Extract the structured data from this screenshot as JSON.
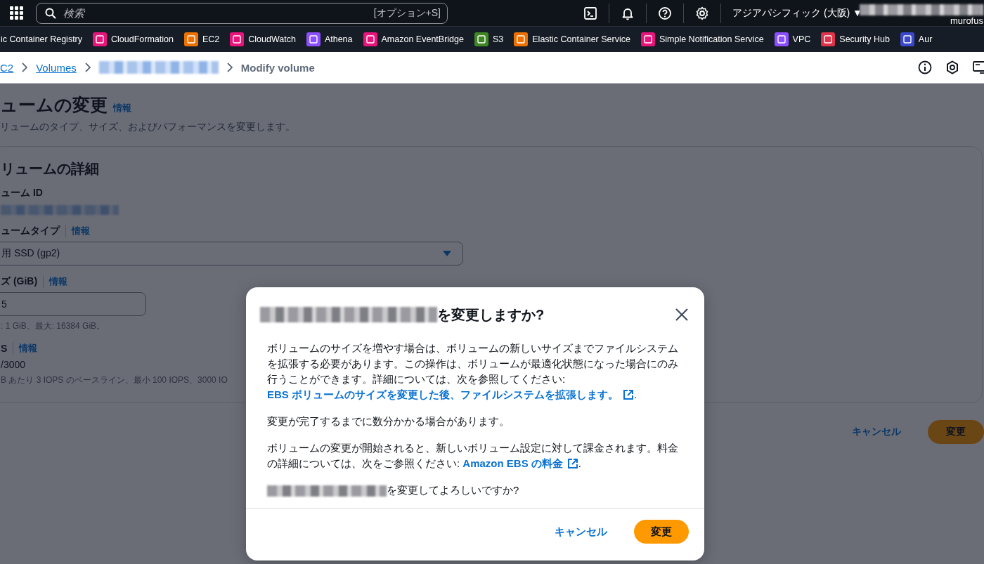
{
  "top_nav": {
    "search": {
      "placeholder": "検索",
      "shortcut": "[オプション+S]"
    },
    "region": {
      "label": "アジアパシフィック (大阪)",
      "caret": "▼"
    },
    "account": {
      "user": "murofus"
    }
  },
  "favorites": [
    {
      "label": "ic Container Registry"
    },
    {
      "label": "CloudFormation",
      "color": "#e7157b"
    },
    {
      "label": "EC2",
      "color": "#ed7100"
    },
    {
      "label": "CloudWatch",
      "color": "#e7157b"
    },
    {
      "label": "Athena",
      "color": "#8c4fff"
    },
    {
      "label": "Amazon EventBridge",
      "color": "#e7157b"
    },
    {
      "label": "S3",
      "color": "#3f8624"
    },
    {
      "label": "Elastic Container Service",
      "color": "#ed7100"
    },
    {
      "label": "Simple Notification Service",
      "color": "#e7157b"
    },
    {
      "label": "VPC",
      "color": "#8c4fff"
    },
    {
      "label": "Security Hub",
      "color": "#dd344c"
    },
    {
      "label": "Aur",
      "color": "#3b48cc"
    }
  ],
  "breadcrumb": [
    {
      "kind": "link",
      "label": "C2"
    },
    {
      "kind": "link",
      "label": "Volumes"
    },
    {
      "kind": "redacted"
    },
    {
      "kind": "current",
      "label": "Modify volume"
    }
  ],
  "page": {
    "title": "ュームの変更",
    "title_info": "情報",
    "description": "リュームのタイプ、サイズ、およびパフォーマンスを変更します。",
    "panel": {
      "heading": "リュームの詳細",
      "fields": [
        {
          "kind": "readonly",
          "label": "ューム ID",
          "redacted": true
        },
        {
          "kind": "select",
          "label": "ュームタイプ",
          "info": "情報",
          "value": "用 SSD (gp2)"
        },
        {
          "kind": "input",
          "label": "ズ (GiB)",
          "info": "情報",
          "value": "5",
          "hint": ": 1 GiB、最大: 16384 GiB。"
        },
        {
          "kind": "readonly",
          "label": "S",
          "info": "情報",
          "value": "/3000",
          "hint": "B あたり 3 IOPS のベースライン、最小 100 IOPS、3000 IO"
        }
      ]
    },
    "actions": {
      "cancel": "キャンセル",
      "submit": "変更"
    }
  },
  "modal": {
    "title": "を変更しますか?",
    "paragraphs": [
      [
        {
          "kind": "text",
          "text": "ボリュームのサイズを増やす場合は、ボリュームの新しいサイズまでファイルシステムを拡張する必要があります。この操作は、ボリュームが最適化状態になった場合にのみ行うことができます。詳細については、次を参照してください: "
        },
        {
          "kind": "link",
          "text": "EBS ボリュームのサイズを変更した後、ファイルシステムを拡張します。",
          "external": true
        },
        {
          "kind": "text",
          "text": "."
        }
      ],
      [
        {
          "kind": "text",
          "text": "変更が完了するまでに数分かかる場合があります。"
        }
      ],
      [
        {
          "kind": "text",
          "text": "ボリュームの変更が開始されると、新しいボリューム設定に対して課金されます。料金の詳細については、次をご参照ください: "
        },
        {
          "kind": "link",
          "text": "Amazon EBS の料金",
          "external": true
        },
        {
          "kind": "text",
          "text": "."
        }
      ],
      [
        {
          "kind": "redacted"
        },
        {
          "kind": "text",
          "text": "を変更してよろしいですか?"
        }
      ]
    ],
    "actions": {
      "cancel": "キャンセル",
      "submit": "変更"
    }
  }
}
